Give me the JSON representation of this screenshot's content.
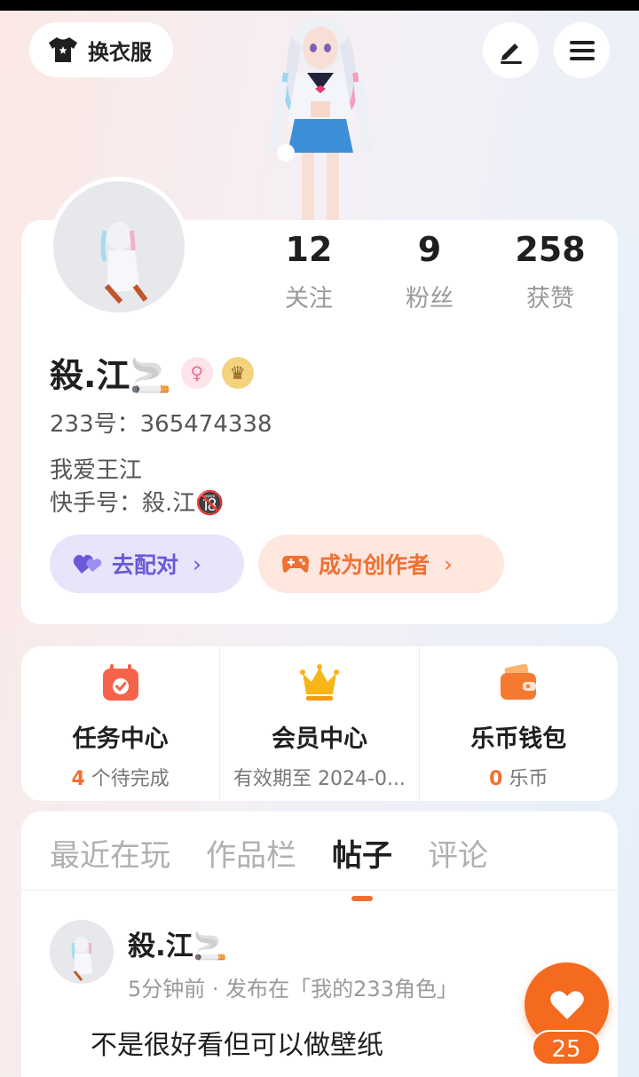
{
  "header": {
    "dress_label": "换衣服"
  },
  "profile": {
    "stats": [
      {
        "value": "12",
        "label": "关注"
      },
      {
        "value": "9",
        "label": "粉丝"
      },
      {
        "value": "258",
        "label": "获赞"
      }
    ],
    "name": "殺.江🚬",
    "id_line": "233号：365474338",
    "bio_line1": "我爱王江",
    "bio_line2": "快手号：殺.江🔞",
    "match_label": "去配对",
    "creator_label": "成为创作者",
    "gender_icon": "female-icon",
    "crown_icon": "crown-icon"
  },
  "features": [
    {
      "title": "任务中心",
      "sub_highlight": "4",
      "sub_text": " 个待完成",
      "icon": "calendar-check-icon"
    },
    {
      "title": "会员中心",
      "sub_highlight": "",
      "sub_text": "有效期至 2024-0...",
      "icon": "crown-icon"
    },
    {
      "title": "乐币钱包",
      "sub_highlight": "0",
      "sub_text": " 乐币",
      "icon": "wallet-icon"
    }
  ],
  "tabs": [
    {
      "label": "最近在玩",
      "active": false
    },
    {
      "label": "作品栏",
      "active": false
    },
    {
      "label": "帖子",
      "active": true
    },
    {
      "label": "评论",
      "active": false
    }
  ],
  "post": {
    "author": "殺.江🚬",
    "meta": "5分钟前 · 发布在「我的233角色」",
    "text": "不是很好看但可以做壁纸"
  },
  "like": {
    "count": "25"
  },
  "colors": {
    "accent": "#f07032",
    "match": "#6a5ad7",
    "match_bg": "#e8e5fb",
    "creator_bg": "#fde7df"
  }
}
